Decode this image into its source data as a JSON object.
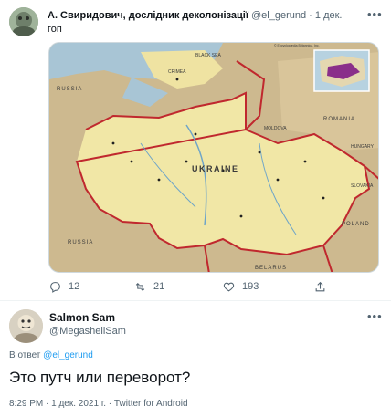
{
  "tweet1": {
    "author_name": "А. Свиридович, дослідник деколонізації",
    "author_handle": "@el_gerund",
    "separator": "·",
    "date": "1 дек.",
    "text": "гоп",
    "more_icon": "more-horizontal-icon",
    "actions": {
      "replies": "12",
      "retweets": "21",
      "likes": "193"
    },
    "map": {
      "country_label": "UKRAINE",
      "labels": {
        "russia": "RUSSIA",
        "russia_bottom": "RUSSIA",
        "belarus": "BELARUS",
        "poland": "POLAND",
        "romania": "ROMANIA",
        "moldova": "MOLDOVA",
        "hungary": "HUNGARY",
        "slovakia": "SLOVAKIA",
        "black_sea": "BLACK SEA",
        "crimea": "CRIMEA",
        "copyright": "© Encyclopædia Britannica, Inc."
      }
    }
  },
  "tweet2": {
    "author_name": "Salmon Sam",
    "author_handle": "@MegashellSam",
    "reply_prefix": "В ответ",
    "reply_handle": "@el_gerund",
    "text": "Это путч или переворот?",
    "meta": "8:29 PM · 1 дек. 2021 г. · Twitter for Android"
  },
  "colors": {
    "accent": "#1d9bf0",
    "text_secondary": "#536471",
    "border_red": "#c0282e"
  }
}
